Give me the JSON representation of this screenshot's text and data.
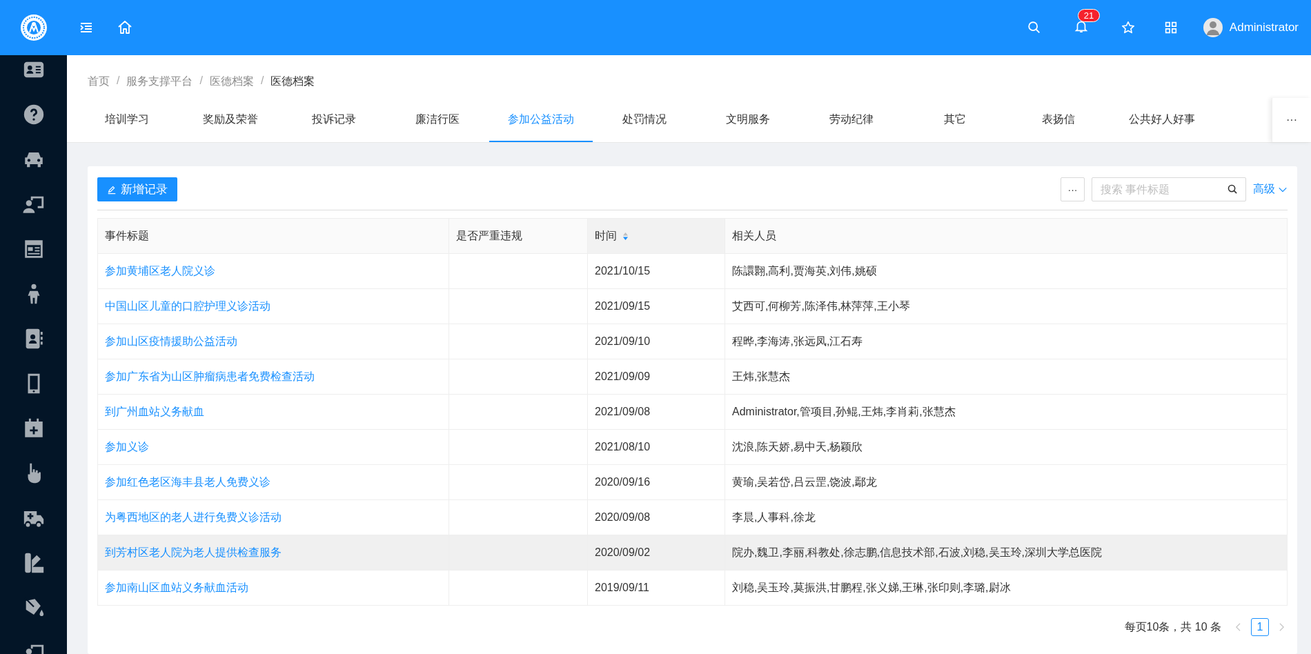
{
  "header": {
    "user": "Administrator",
    "notifications": "21"
  },
  "breadcrumb": {
    "separator": "/",
    "items": [
      "首页",
      "服务支撑平台",
      "医德档案",
      "医德档案"
    ]
  },
  "tabs": [
    {
      "label": "培训学习",
      "selected": false
    },
    {
      "label": "奖励及荣誉",
      "selected": false
    },
    {
      "label": "投诉记录",
      "selected": false
    },
    {
      "label": "廉洁行医",
      "selected": false
    },
    {
      "label": "参加公益活动",
      "selected": true
    },
    {
      "label": "处罚情况",
      "selected": false
    },
    {
      "label": "文明服务",
      "selected": false
    },
    {
      "label": "劳动纪律",
      "selected": false
    },
    {
      "label": "其它",
      "selected": false
    },
    {
      "label": "表扬信",
      "selected": false
    },
    {
      "label": "公共好人好事",
      "selected": false
    }
  ],
  "tabs_more": "···",
  "toolbar": {
    "add_button": "新增记录",
    "more_button": "···",
    "search": {
      "placeholder": "搜索 事件标题"
    },
    "advanced": "高级"
  },
  "table": {
    "columns": [
      {
        "label": "事件标题",
        "sorted": false
      },
      {
        "label": "是否严重违规",
        "sorted": false
      },
      {
        "label": "时间",
        "sorted": true,
        "descending": true
      },
      {
        "label": "相关人员",
        "sorted": false
      }
    ],
    "rows": [
      {
        "title": "参加黄埔区老人院义诊",
        "time": "2021/10/15",
        "people": "陈譞翾,高利,贾海英,刘伟,姚硕",
        "selected": false
      },
      {
        "title": "中国山区儿童的口腔护理义诊活动",
        "time": "2021/09/15",
        "people": "艾西可,何柳芳,陈泽伟,林萍萍,王小琴",
        "selected": false
      },
      {
        "title": "参加山区疫情援助公益活动",
        "time": "2021/09/10",
        "people": "程晔,李海涛,张远凤,江石寿",
        "selected": false
      },
      {
        "title": "参加广东省为山区肿瘤病患者免费检查活动",
        "time": "2021/09/09",
        "people": "王炜,张慧杰",
        "selected": false
      },
      {
        "title": "到广州血站义务献血",
        "time": "2021/09/08",
        "people": "Administrator,管项目,孙鲲,王炜,李肖莉,张慧杰",
        "selected": false
      },
      {
        "title": "参加义诊",
        "time": "2021/08/10",
        "people": "沈浪,陈天娇,易中天,杨颖欣",
        "selected": false
      },
      {
        "title": "参加红色老区海丰县老人免费义诊",
        "time": "2020/09/16",
        "people": "黄瑜,吴若岱,吕云罡,饶波,鄢龙",
        "selected": false
      },
      {
        "title": "为粤西地区的老人进行免费义诊活动",
        "time": "2020/09/08",
        "people": "李晨,人事科,徐龙",
        "selected": false
      },
      {
        "title": "到芳村区老人院为老人提供检查服务",
        "time": "2020/09/02",
        "people": "院办,魏卫,李丽,科教处,徐志鹏,信息技术部,石波,刘稳,吴玉玲,深圳大学总医院",
        "selected": true
      },
      {
        "title": "参加南山区血站义务献血活动",
        "time": "2019/09/11",
        "people": "刘稳,吴玉玲,莫振洪,甘鹏程,张义娣,王琳,张印则,李璐,尉冰",
        "selected": false
      }
    ]
  },
  "pagination": {
    "summary": "每页10条，共 10 条",
    "prev_disabled": true,
    "next_disabled": true,
    "pages": [
      {
        "label": "1",
        "selected": true
      }
    ]
  }
}
